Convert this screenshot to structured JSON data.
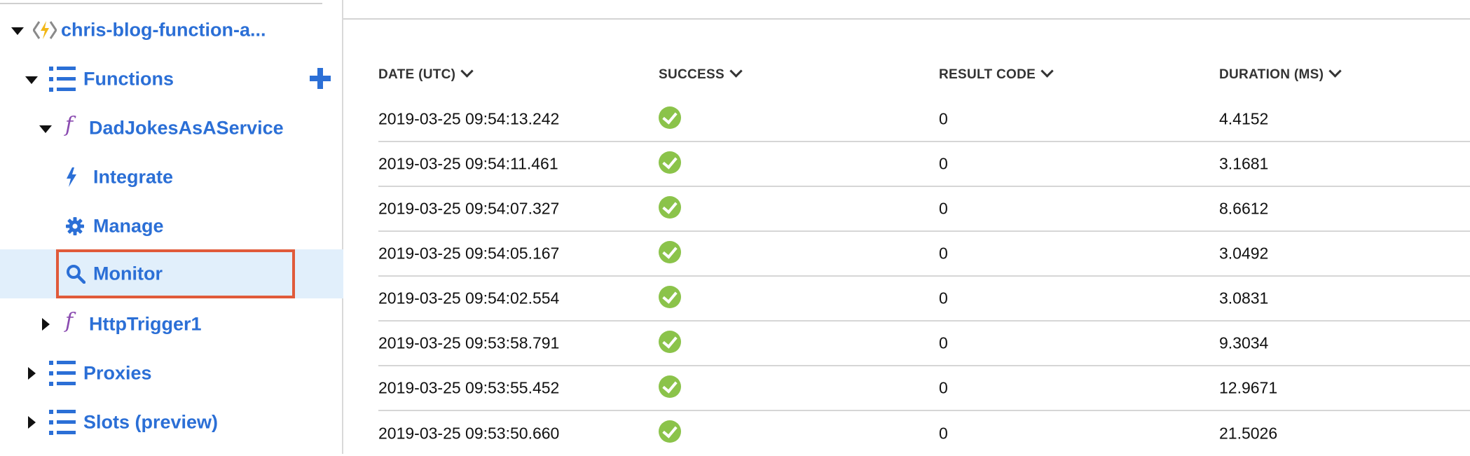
{
  "sidebar": {
    "app_name": "chris-blog-function-a...",
    "add_icon": "plus-icon",
    "items": [
      {
        "label": "Functions",
        "icon": "list-icon"
      },
      {
        "label": "DadJokesAsAService",
        "icon": "function-icon"
      },
      {
        "label": "Integrate",
        "icon": "lightning-icon"
      },
      {
        "label": "Manage",
        "icon": "gear-icon"
      },
      {
        "label": "Monitor",
        "icon": "search-icon"
      },
      {
        "label": "HttpTrigger1",
        "icon": "function-icon"
      },
      {
        "label": "Proxies",
        "icon": "list-icon"
      },
      {
        "label": "Slots (preview)",
        "icon": "list-icon"
      }
    ]
  },
  "table": {
    "headers": [
      "DATE (UTC)",
      "SUCCESS",
      "RESULT CODE",
      "DURATION (MS)"
    ],
    "rows": [
      {
        "date": "2019-03-25 09:54:13.242",
        "success": true,
        "code": "0",
        "duration": "4.4152"
      },
      {
        "date": "2019-03-25 09:54:11.461",
        "success": true,
        "code": "0",
        "duration": "3.1681"
      },
      {
        "date": "2019-03-25 09:54:07.327",
        "success": true,
        "code": "0",
        "duration": "8.6612"
      },
      {
        "date": "2019-03-25 09:54:05.167",
        "success": true,
        "code": "0",
        "duration": "3.0492"
      },
      {
        "date": "2019-03-25 09:54:02.554",
        "success": true,
        "code": "0",
        "duration": "3.0831"
      },
      {
        "date": "2019-03-25 09:53:58.791",
        "success": true,
        "code": "0",
        "duration": "9.3034"
      },
      {
        "date": "2019-03-25 09:53:55.452",
        "success": true,
        "code": "0",
        "duration": "12.9671"
      },
      {
        "date": "2019-03-25 09:53:50.660",
        "success": true,
        "code": "0",
        "duration": "21.5026"
      }
    ]
  },
  "colors": {
    "link_blue": "#2b6fd6",
    "selected_bg": "#e1effb",
    "highlight_border": "#e05a3a",
    "success_green": "#8bc34a",
    "function_purple": "#8a4bb0"
  }
}
